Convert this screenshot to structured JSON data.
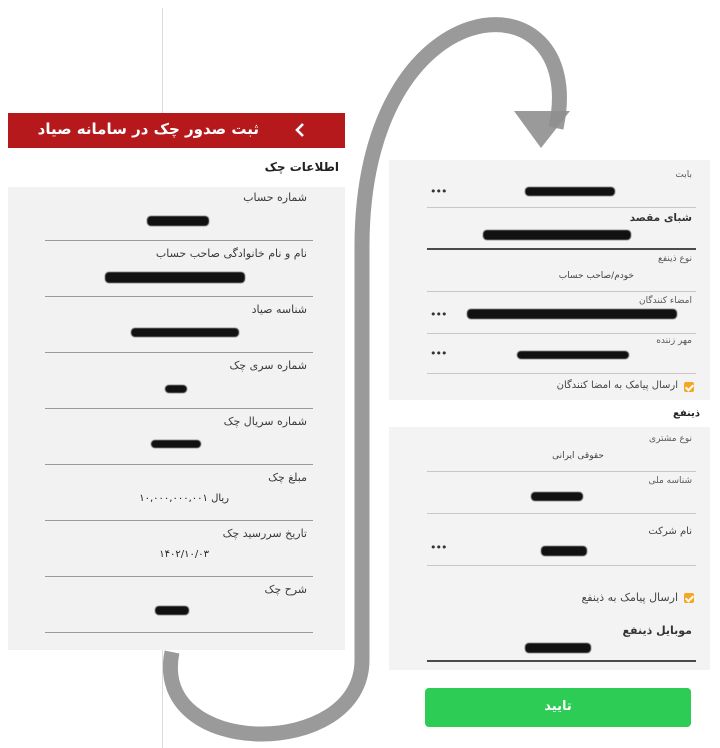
{
  "header": {
    "title": "ثبت صدور چک در سامانه صیاد",
    "back_icon": "chevron-left-icon"
  },
  "section_title": "اطلاعات چک",
  "fields": [
    {
      "label": "شماره حساب",
      "value": ""
    },
    {
      "label": "نام و نام خانوادگی صاحب حساب",
      "value": ""
    },
    {
      "label": "شناسه صیاد",
      "value": ""
    },
    {
      "label": "شماره سری چک",
      "value": ""
    },
    {
      "label": "شماره سریال چک",
      "value": ""
    },
    {
      "label": "مبلغ چک",
      "value": "۱۰,۰۰۰,۰۰۰,۰۰۱ ریال"
    },
    {
      "label": "تاریخ سررسید چک",
      "value": "۱۴۰۲/۱۰/۰۳"
    },
    {
      "label": "شرح چک",
      "value": ""
    }
  ],
  "right_top": {
    "babat_label": "بابت",
    "sheba_label": "شبای مقصد",
    "zinaf_type_label": "نوع ذینفع",
    "zinaf_type_value": "خودم/صاحب حساب",
    "signers_label": "امضاء کنندگان",
    "stamp_label": "مهر زننده",
    "sms_signers_label": "ارسال پیامک به امضا کنندگان",
    "dots": "•••"
  },
  "right_bottom": {
    "section_title": "ذینفع",
    "customer_type_label": "نوع مشتری",
    "customer_type_value": "حقوقی ایرانی",
    "national_id_label": "شناسه ملی",
    "company_name_label": "نام شرکت",
    "sms_zinaf_label": "ارسال پیامک به ذینفع",
    "mobile_label": "موبایل ذینفع",
    "dots": "•••"
  },
  "confirm_label": "تایید",
  "colors": {
    "header": "#b5191c",
    "confirm": "#2ccc55",
    "checkbox": "#f5a623",
    "arrow": "#8f8f8f"
  }
}
